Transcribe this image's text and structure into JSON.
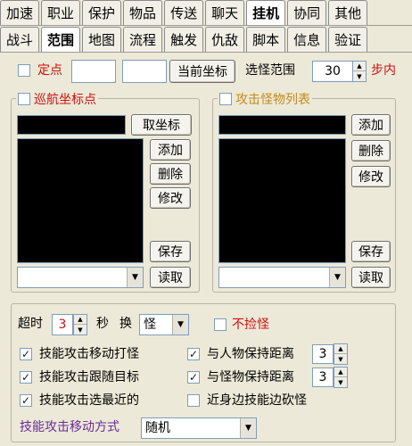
{
  "tabs_row1": [
    "加速",
    "职业",
    "保护",
    "物品",
    "传送",
    "聊天",
    "挂机",
    "协同",
    "其他"
  ],
  "tabs_row2": [
    "战斗",
    "范围",
    "地图",
    "流程",
    "触发",
    "仇敌",
    "脚本",
    "信息",
    "验证"
  ],
  "active_row1": "挂机",
  "active_row2": "范围",
  "top": {
    "fixed_point_label": "定点",
    "coord_x": "",
    "coord_y": "",
    "current_coord_button": "当前坐标",
    "range_label": "选怪范围",
    "range_value": "30",
    "range_unit": "步内"
  },
  "patrol": {
    "title": "巡航坐标点",
    "get_coord_button": "取坐标",
    "add_button": "添加",
    "delete_button": "删除",
    "edit_button": "修改",
    "save_button": "保存",
    "load_button": "读取",
    "combo_value": ""
  },
  "monster": {
    "title": "攻击怪物列表",
    "add_button": "添加",
    "delete_button": "删除",
    "edit_button": "修改",
    "save_button": "保存",
    "load_button": "读取",
    "combo_value": ""
  },
  "bottom": {
    "timeout_label": "超时",
    "timeout_value": "3",
    "seconds_label": "秒",
    "switch_label": "换",
    "switch_value": "怪",
    "no_pickup_label": "不捡怪",
    "skill_move_attack": "技能攻击移动打怪",
    "skill_follow_target": "技能攻击跟随目标",
    "skill_nearest": "技能攻击选最近的",
    "keep_dist_player": "与人物保持距离",
    "keep_dist_player_value": "3",
    "keep_dist_monster": "与怪物保持距离",
    "keep_dist_monster_value": "3",
    "melee_kite": "近身边技能边砍怪",
    "move_mode_label": "技能攻击移动方式",
    "move_mode_value": "随机"
  }
}
